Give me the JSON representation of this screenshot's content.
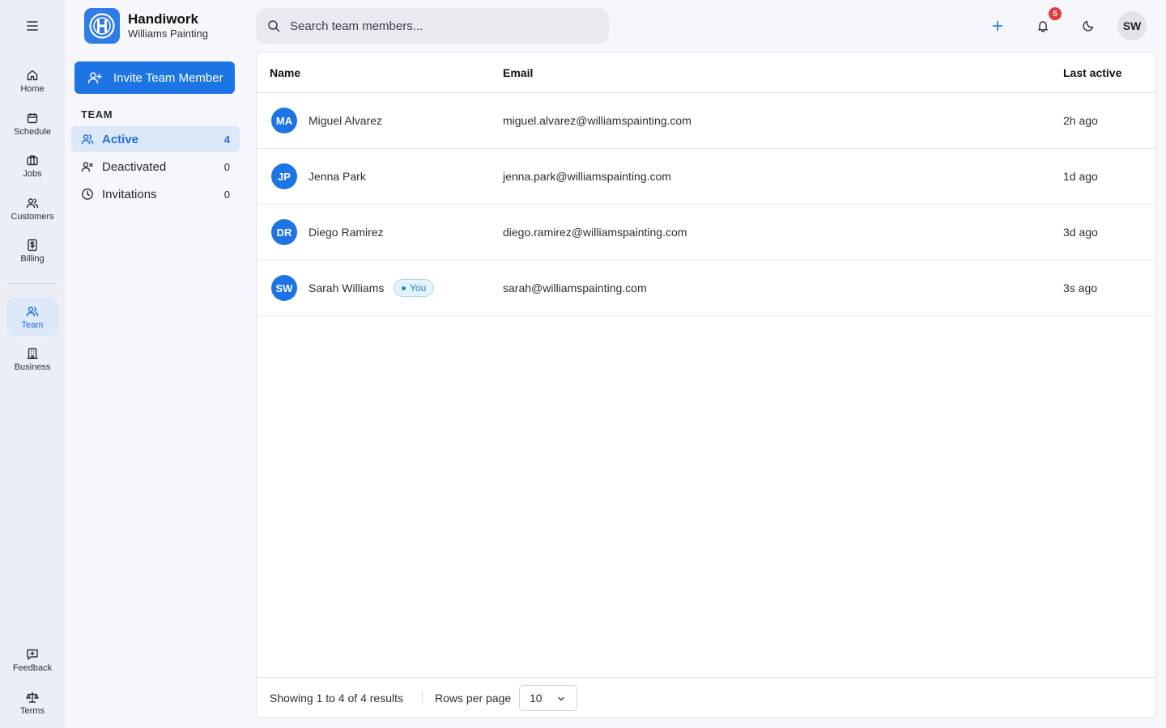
{
  "rail": {
    "items": [
      {
        "label": "Home",
        "icon": "home-icon"
      },
      {
        "label": "Schedule",
        "icon": "calendar-icon"
      },
      {
        "label": "Jobs",
        "icon": "briefcase-icon"
      },
      {
        "label": "Customers",
        "icon": "users-icon"
      },
      {
        "label": "Billing",
        "icon": "dollar-icon"
      },
      {
        "label": "Team",
        "icon": "team-icon"
      },
      {
        "label": "Business",
        "icon": "building-icon"
      },
      {
        "label": "Feedback",
        "icon": "feedback-icon"
      },
      {
        "label": "Terms",
        "icon": "scale-icon"
      }
    ],
    "active": "Team"
  },
  "brand": {
    "name": "Handiwork",
    "subtitle": "Williams Painting"
  },
  "sidebar": {
    "invite_label": "Invite Team Member",
    "section_title": "TEAM",
    "items": [
      {
        "label": "Active",
        "count": "4"
      },
      {
        "label": "Deactivated",
        "count": "0"
      },
      {
        "label": "Invitations",
        "count": "0"
      }
    ]
  },
  "search": {
    "placeholder": "Search team members..."
  },
  "topbar": {
    "notification_count": "5",
    "user_initials": "SW"
  },
  "table": {
    "columns": {
      "name": "Name",
      "email": "Email",
      "last_active": "Last active"
    },
    "rows": [
      {
        "initials": "MA",
        "name": "Miguel Alvarez",
        "email": "miguel.alvarez@williamspainting.com",
        "last_active": "2h ago"
      },
      {
        "initials": "JP",
        "name": "Jenna Park",
        "email": "jenna.park@williamspainting.com",
        "last_active": "1d ago"
      },
      {
        "initials": "DR",
        "name": "Diego Ramirez",
        "email": "diego.ramirez@williamspainting.com",
        "last_active": "3d ago"
      },
      {
        "initials": "SW",
        "name": "Sarah Williams",
        "badge": "You",
        "email": "sarah@williamspainting.com",
        "last_active": "3s ago"
      }
    ]
  },
  "footer": {
    "showing": "Showing 1 to 4 of 4 results",
    "rows_per_page_label": "Rows per page",
    "rows_per_page_value": "10"
  },
  "colors": {
    "accent": "#1d74e5",
    "rail_bg": "#eceef5",
    "active_bg": "#dde8f8",
    "badge_red": "#e53a3a"
  }
}
